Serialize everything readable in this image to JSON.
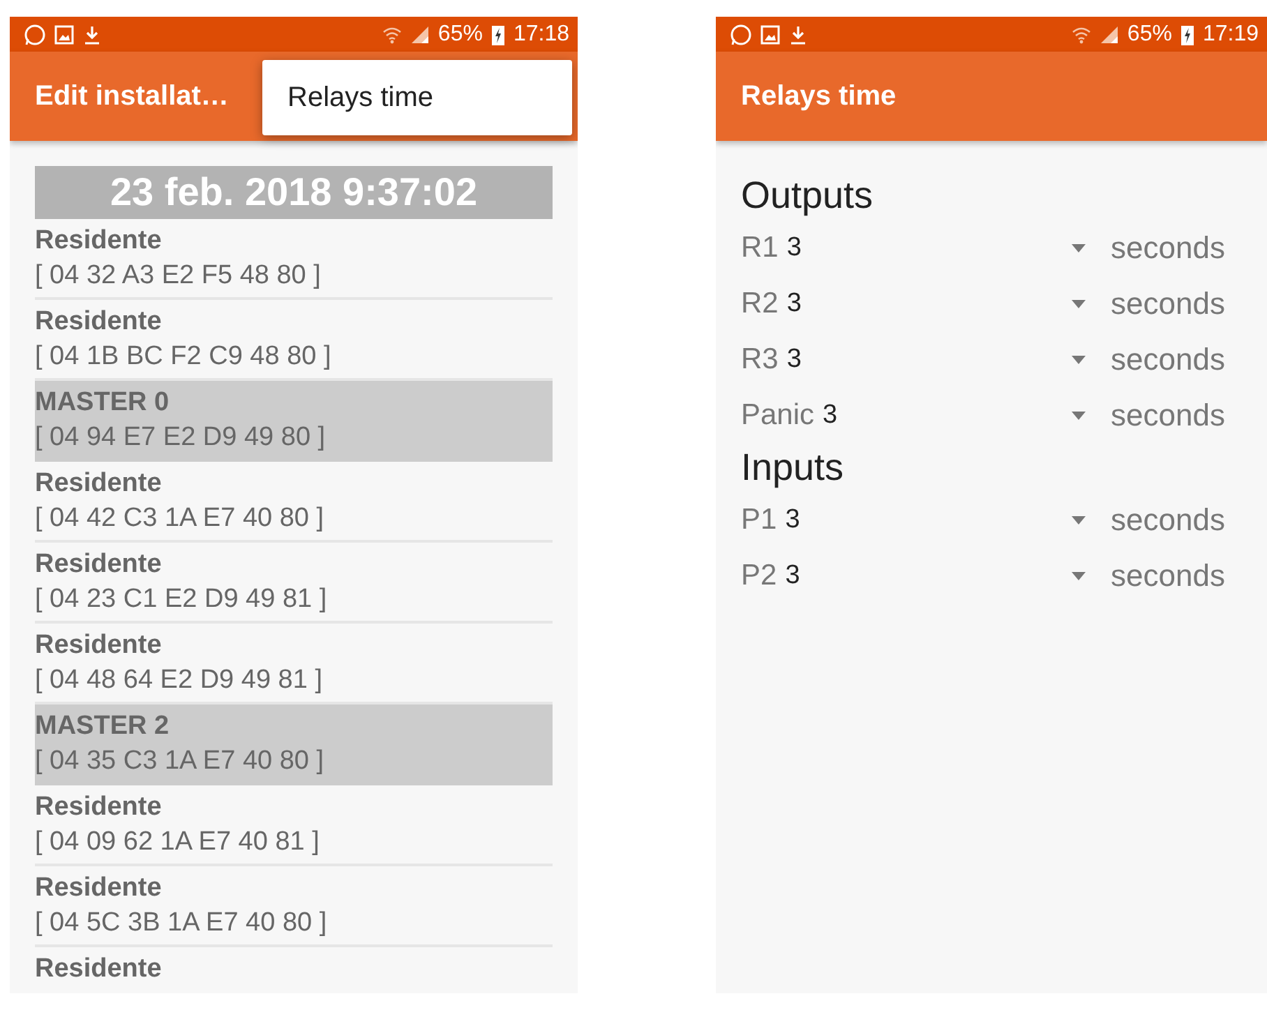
{
  "screens": [
    {
      "status_bar": {
        "battery": "65%",
        "time": "17:18"
      },
      "app_bar": {
        "title": "Edit installat…"
      },
      "menu": {
        "items": [
          "Relays time"
        ]
      },
      "date_header": "23 feb. 2018 9:37:02",
      "rows": [
        {
          "name": "Residente",
          "id": "[ 04 32 A3 E2 F5 48 80 ]",
          "highlighted": false
        },
        {
          "name": "Residente",
          "id": "[ 04 1B BC F2 C9 48 80 ]",
          "highlighted": false
        },
        {
          "name": "MASTER 0",
          "id": "[ 04 94 E7 E2 D9 49 80 ]",
          "highlighted": true
        },
        {
          "name": "Residente",
          "id": "[ 04 42 C3 1A E7 40 80 ]",
          "highlighted": false
        },
        {
          "name": "Residente",
          "id": "[ 04 23 C1 E2 D9 49 81 ]",
          "highlighted": false
        },
        {
          "name": "Residente",
          "id": "[ 04 48 64 E2 D9 49 81 ]",
          "highlighted": false
        },
        {
          "name": "MASTER 2",
          "id": "[ 04 35 C3 1A E7 40 80 ]",
          "highlighted": true
        },
        {
          "name": "Residente",
          "id": "[ 04 09 62 1A E7 40 81 ]",
          "highlighted": false
        },
        {
          "name": "Residente",
          "id": "[ 04 5C 3B 1A E7 40 80 ]",
          "highlighted": false
        },
        {
          "name": "Residente",
          "highlighted": false
        }
      ]
    },
    {
      "status_bar": {
        "battery": "65%",
        "time": "17:19"
      },
      "app_bar": {
        "title": "Relays time"
      },
      "sections": [
        {
          "title": "Outputs",
          "rows": [
            {
              "label": "R1",
              "value": "3",
              "unit": "seconds"
            },
            {
              "label": "R2",
              "value": "3",
              "unit": "seconds"
            },
            {
              "label": "R3",
              "value": "3",
              "unit": "seconds"
            },
            {
              "label": "Panic",
              "value": "3",
              "unit": "seconds"
            }
          ]
        },
        {
          "title": "Inputs",
          "rows": [
            {
              "label": "P1",
              "value": "3",
              "unit": "seconds"
            },
            {
              "label": "P2",
              "value": "3",
              "unit": "seconds"
            }
          ]
        }
      ]
    }
  ]
}
